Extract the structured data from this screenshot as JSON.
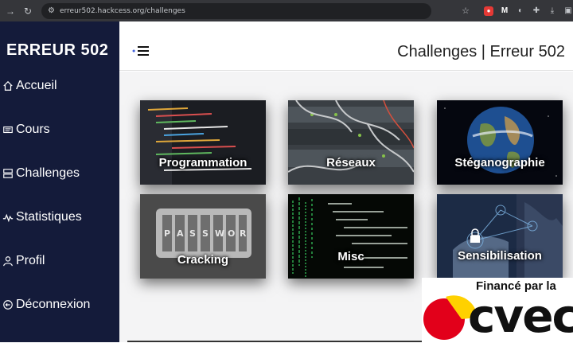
{
  "browser": {
    "url": "erreur502.hackcess.org/challenges"
  },
  "sidebar": {
    "brand": "ERREUR 502",
    "items": [
      {
        "label": "Accueil",
        "icon": "home-icon"
      },
      {
        "label": "Cours",
        "icon": "book-icon"
      },
      {
        "label": "Challenges",
        "icon": "server-icon"
      },
      {
        "label": "Statistiques",
        "icon": "chart-line-icon"
      },
      {
        "label": "Profil",
        "icon": "user-icon"
      },
      {
        "label": "Déconnexion",
        "icon": "logout-icon"
      }
    ]
  },
  "header": {
    "title": "Challenges | Erreur 502"
  },
  "cards": [
    {
      "label": "Programmation",
      "icon": "code-image"
    },
    {
      "label": "Réseaux",
      "icon": "network-image"
    },
    {
      "label": "Stéganographie",
      "icon": "earth-image"
    },
    {
      "label": "Cracking",
      "icon": "password-lock-image"
    },
    {
      "label": "Misc",
      "icon": "terminal-image"
    },
    {
      "label": "Sensibilisation",
      "icon": "security-hand-image"
    }
  ],
  "sponsor": {
    "caption": "Financé par la",
    "name": "cvec"
  },
  "colors": {
    "sidebar": "#141b3a",
    "browser": "#35363a",
    "sponsor_red": "#e2001a",
    "sponsor_yellow": "#ffd100"
  }
}
